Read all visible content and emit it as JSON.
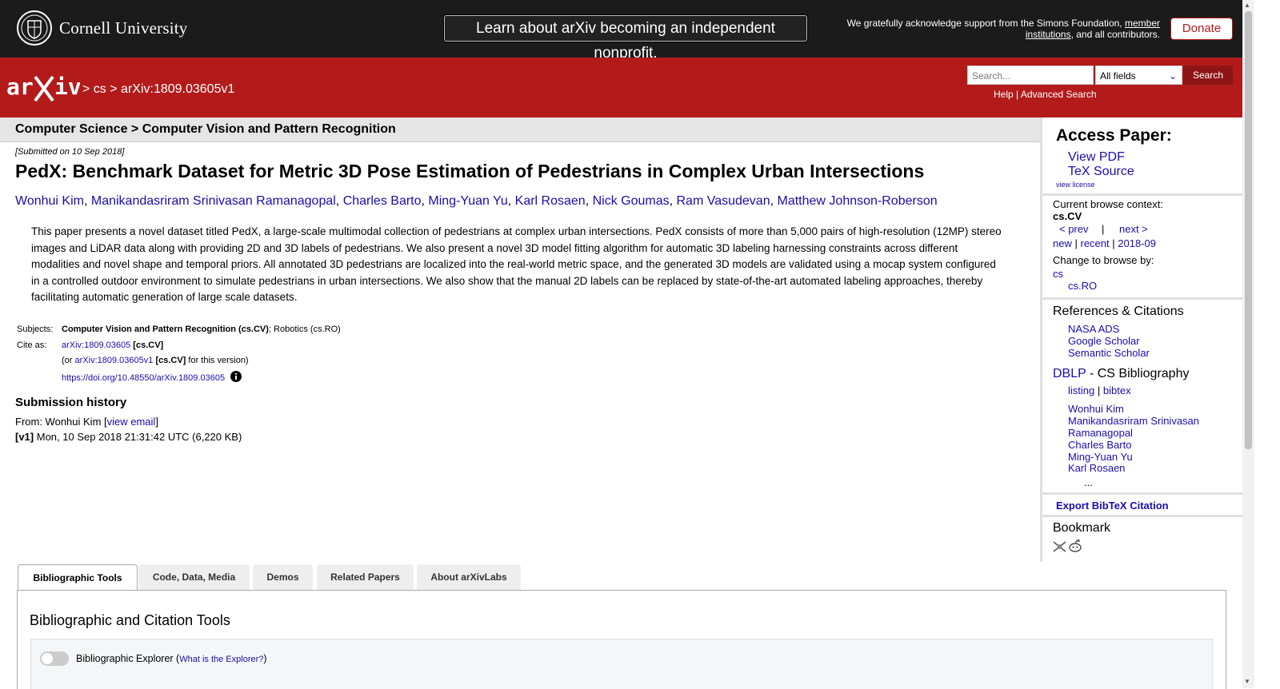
{
  "top": {
    "university": "Cornell University",
    "nonprofit_banner": "Learn about arXiv becoming an independent nonprofit.",
    "ack_text": "We gratefully acknowledge support from the Simons Foundation,",
    "ack_link": "member institutions",
    "ack_tail": ", and all contributors.",
    "donate": "Donate"
  },
  "header": {
    "crumb_sep1": ">",
    "crumb_cs": "cs",
    "crumb_sep2": ">",
    "crumb_id": "arXiv:1809.03605v1",
    "search_placeholder": "Search...",
    "search_field": "All fields",
    "search_button": "Search",
    "help": "Help",
    "help_sep": "|",
    "advanced": "Advanced Search"
  },
  "paper": {
    "category": "Computer Science > Computer Vision and Pattern Recognition",
    "submitted": "[Submitted on 10 Sep 2018]",
    "title": "PedX: Benchmark Dataset for Metric 3D Pose Estimation of Pedestrians in Complex Urban Intersections",
    "authors": [
      "Wonhui Kim",
      "Manikandasriram Srinivasan Ramanagopal",
      "Charles Barto",
      "Ming-Yuan Yu",
      "Karl Rosaen",
      "Nick Goumas",
      "Ram Vasudevan",
      "Matthew Johnson-Roberson"
    ],
    "abstract": "This paper presents a novel dataset titled PedX, a large-scale multimodal collection of pedestrians at complex urban intersections. PedX consists of more than 5,000 pairs of high-resolution (12MP) stereo images and LiDAR data along with providing 2D and 3D labels of pedestrians. We also present a novel 3D model fitting algorithm for automatic 3D labeling harnessing constraints across different modalities and novel shape and temporal priors. All annotated 3D pedestrians are localized into the real-world metric space, and the generated 3D models are validated using a mocap system configured in a controlled outdoor environment to simulate pedestrians in urban intersections. We also show that the manual 2D labels can be replaced by state-of-the-art automated labeling approaches, thereby facilitating automatic generation of large scale datasets.",
    "subjects_label": "Subjects:",
    "subjects_primary": "Computer Vision and Pattern Recognition (cs.CV)",
    "subjects_rest": "; Robotics (cs.RO)",
    "cite_label": "Cite as:",
    "cite_id": "arXiv:1809.03605",
    "cite_cat": "[cs.CV]",
    "cite_or": "(or",
    "cite_version_id": "arXiv:1809.03605v1",
    "cite_version_cat": "[cs.CV]",
    "cite_version_tail": "for this version)",
    "doi": "https://doi.org/10.48550/arXiv.1809.03605",
    "history_title": "Submission history",
    "from_prefix": "From: Wonhui Kim [",
    "view_email": "view email",
    "from_suffix": "]",
    "v1_label": "[v1]",
    "v1_text": "Mon, 10 Sep 2018 21:31:42 UTC (6,220 KB)"
  },
  "sidebar": {
    "access_title": "Access Paper:",
    "view_pdf": "View PDF",
    "tex_source": "TeX Source",
    "view_license": "view license",
    "context_label": "Current browse context:",
    "context_value": "cs.CV",
    "prev": "< prev",
    "sep": "|",
    "next": "next >",
    "new": "new",
    "recent": "recent",
    "month": "2018-09",
    "change_label": "Change to browse by:",
    "browse_cs": "cs",
    "browse_ro": "cs.RO",
    "refs_title": "References & Citations",
    "nasa": "NASA ADS",
    "google": "Google Scholar",
    "semantic": "Semantic Scholar",
    "dblp": "DBLP",
    "dblp_tail": " - CS Bibliography",
    "listing": "listing",
    "bibtex": "bibtex",
    "dblp_authors": [
      "Wonhui Kim",
      "Manikandasriram Srinivasan",
      "Ramanagopal",
      "Charles Barto",
      "Ming-Yuan Yu",
      "Karl Rosaen"
    ],
    "ellipsis": "...",
    "export": "Export BibTeX Citation",
    "bookmark": "Bookmark"
  },
  "tabs": [
    "Bibliographic Tools",
    "Code, Data, Media",
    "Demos",
    "Related Papers",
    "About arXivLabs"
  ],
  "bib": {
    "title": "Bibliographic and Citation Tools",
    "explorer": "Bibliographic Explorer (",
    "what": "What is the Explorer?",
    "close": ")"
  },
  "colors": {
    "arxiv_red": "#b31b1b",
    "link": "#1a0dab",
    "topbar": "#1b1b1b"
  }
}
